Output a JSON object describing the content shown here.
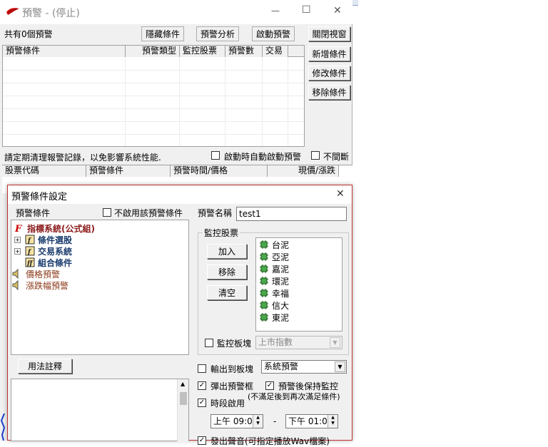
{
  "window": {
    "title": "預警 - (停止)",
    "minimize": "—",
    "maximize": "☐",
    "close": "✕"
  },
  "top": {
    "count_text": "共有0個預警",
    "buttons": [
      "隱藏條件",
      "預警分析",
      "啟動預警"
    ]
  },
  "side_buttons": [
    "關閉視窗",
    "新增條件",
    "修改條件",
    "移除條件"
  ],
  "alert_table": {
    "headers": [
      "預警條件",
      "預警類型",
      "監控股票",
      "預警數",
      "交易"
    ]
  },
  "status_bar": {
    "note": "請定期清理報警記錄，以免影響系統性能.",
    "auto_start_label": "啟動時自動啟動預警",
    "continuous_label": "不間斷"
  },
  "record_table": {
    "headers": [
      "股票代碼",
      "預警條件",
      "預警時間/價格",
      "現價/漲跌"
    ]
  },
  "dialog": {
    "title": "預警條件設定",
    "close": "✕",
    "condition_label": "預警條件",
    "disable_label": "不啟用該預警條件",
    "name_label": "預警名稱",
    "name_value": "test1",
    "tree": [
      {
        "label": "指標系統(公式組)",
        "icon": "formula-flag-icon"
      },
      {
        "label": "條件選股",
        "icon": "formula-doc-icon"
      },
      {
        "label": "交易系統",
        "icon": "formula-doc-icon"
      },
      {
        "label": "組合條件",
        "icon": "formula-doc-icon"
      },
      {
        "label": "價格預警",
        "icon": "speaker-icon"
      },
      {
        "label": "漲跌幅預警",
        "icon": "speaker-icon"
      }
    ],
    "usage_button": "用法註釋",
    "monitor": {
      "group_title": "監控股票",
      "add": "加入",
      "remove": "移除",
      "clear": "清空",
      "stocks": [
        "台泥",
        "亞泥",
        "嘉泥",
        "環泥",
        "幸福",
        "信大",
        "東泥"
      ],
      "board_label": "監控板塊",
      "board_value": "上市指數"
    },
    "output_label": "輸出到板塊",
    "output_value": "系統預警",
    "popup_label": "彈出預警框",
    "keep_label": "預警後保持監控",
    "keep_note": "(不滿足後到再次滿足條件)",
    "period_label": "時段啟用",
    "time_start": "上午 09:0",
    "time_sep": "-",
    "time_end": "下午 01:0",
    "sound_label": "發出聲音(可指定播放Wav檔案)"
  }
}
